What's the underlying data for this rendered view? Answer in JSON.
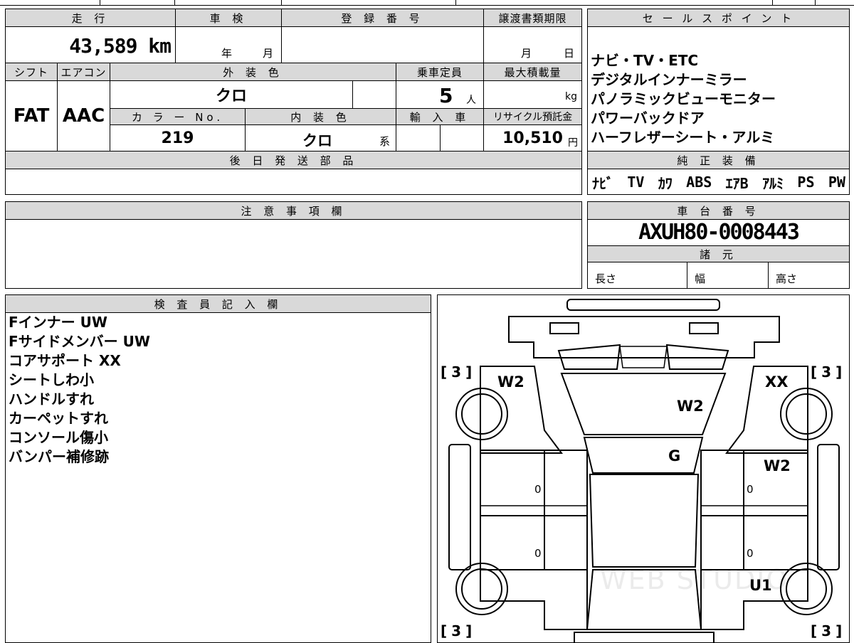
{
  "basic": {
    "mileage_label": "走 行",
    "mileage_value": "43,589 km",
    "shaken_label": "車 検",
    "shaken_year": "年",
    "shaken_month": "月",
    "reg_label": "登 録 番 号",
    "transfer_label": "譲渡書類期限",
    "transfer_month": "月",
    "transfer_day": "日",
    "shift_label": "シフト",
    "shift_value": "FAT",
    "ac_label": "エアコン",
    "ac_value": "AAC",
    "exterior_label": "外 装 色",
    "exterior_value": "クロ",
    "capacity_label": "乗車定員",
    "capacity_value": "5",
    "capacity_unit": "人",
    "maxload_label": "最大積載量",
    "maxload_unit": "kg",
    "color_no_label": "カ ラ ー No.",
    "color_no_value": "219",
    "interior_label": "内 装 色",
    "interior_value": "クロ",
    "interior_suffix": "系",
    "import_label": "輸 入 車",
    "recycle_label": "リサイクル預託金",
    "recycle_value": "10,510",
    "recycle_unit": "円",
    "later_parts_label": "後 日 発 送 部 品"
  },
  "sales_points": {
    "label": "セ ー ル ス ポ イ ン ト",
    "lines": [
      "ナビ・TV・ETC",
      "デジタルインナーミラー",
      "パノラミックビューモニター",
      "パワーバックドア",
      "ハーフレザーシート・アルミ"
    ]
  },
  "equipment": {
    "label": "純 正 装 備",
    "items": [
      "ﾅﾋﾞ",
      "TV",
      "ｶﾜ",
      "ABS",
      "ｴｱB",
      "ｱﾙﾐ",
      "PS",
      "PW"
    ]
  },
  "notes": {
    "label": "注 意 事 項 欄"
  },
  "chassis": {
    "label": "車 台 番 号",
    "value": "AXUH80-0008443",
    "specs_label": "諸 元",
    "length_label": "長さ",
    "width_label": "幅",
    "height_label": "高さ"
  },
  "inspector": {
    "label": "検 査 員 記 入 欄",
    "lines": [
      "Fインナー UW",
      "Fサイドメンバー UW",
      "コアサポート XX",
      "シートしわ小",
      "ハンドルすれ",
      "カーペットすれ",
      "コンソール傷小",
      "バンパー補修跡"
    ]
  },
  "diagram": {
    "tire_fl": "3",
    "tire_fr": "3",
    "tire_rl": "3",
    "tire_rr": "3",
    "marks": {
      "left_front_fender": "W2",
      "hood": "W2",
      "right_front_fender": "XX",
      "windshield": "G",
      "right_front_door": "W2",
      "right_rear_quarter": "U1"
    },
    "door_zeros": [
      "0",
      "0",
      "0",
      "0"
    ],
    "watermark": "WEB STUDIO"
  }
}
